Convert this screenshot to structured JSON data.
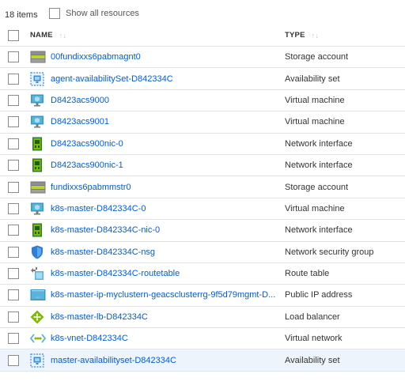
{
  "toolbar": {
    "item_count": "18 items",
    "show_all_label": "Show all resources"
  },
  "table": {
    "columns": {
      "name": "NAME",
      "type": "TYPE",
      "sort_glyph": "↑↓"
    },
    "rows": [
      {
        "name": "00fundixxs6pabmagnt0",
        "type": "Storage account",
        "icon": "storage-account-icon"
      },
      {
        "name": "agent-availabilitySet-D842334C",
        "type": "Availability set",
        "icon": "availability-set-icon"
      },
      {
        "name": "D8423acs9000",
        "type": "Virtual machine",
        "icon": "virtual-machine-icon"
      },
      {
        "name": "D8423acs9001",
        "type": "Virtual machine",
        "icon": "virtual-machine-icon"
      },
      {
        "name": "D8423acs900nic-0",
        "type": "Network interface",
        "icon": "network-interface-icon"
      },
      {
        "name": "D8423acs900nic-1",
        "type": "Network interface",
        "icon": "network-interface-icon"
      },
      {
        "name": "fundixxs6pabmmstr0",
        "type": "Storage account",
        "icon": "storage-account-icon"
      },
      {
        "name": "k8s-master-D842334C-0",
        "type": "Virtual machine",
        "icon": "virtual-machine-icon"
      },
      {
        "name": "k8s-master-D842334C-nic-0",
        "type": "Network interface",
        "icon": "network-interface-icon"
      },
      {
        "name": "k8s-master-D842334C-nsg",
        "type": "Network security group",
        "icon": "network-security-group-icon"
      },
      {
        "name": "k8s-master-D842334C-routetable",
        "type": "Route table",
        "icon": "route-table-icon"
      },
      {
        "name": "k8s-master-ip-myclustern-geacsclusterrg-9f5d79mgmt-D...",
        "type": "Public IP address",
        "icon": "public-ip-icon"
      },
      {
        "name": "k8s-master-lb-D842334C",
        "type": "Load balancer",
        "icon": "load-balancer-icon"
      },
      {
        "name": "k8s-vnet-D842334C",
        "type": "Virtual network",
        "icon": "virtual-network-icon"
      },
      {
        "name": "master-availabilityset-D842334C",
        "type": "Availability set",
        "icon": "availability-set-icon",
        "selected": true
      }
    ]
  },
  "colors": {
    "link": "#015cda",
    "selected_row": "#edf4fb",
    "row_border": "#e3e3e3"
  }
}
